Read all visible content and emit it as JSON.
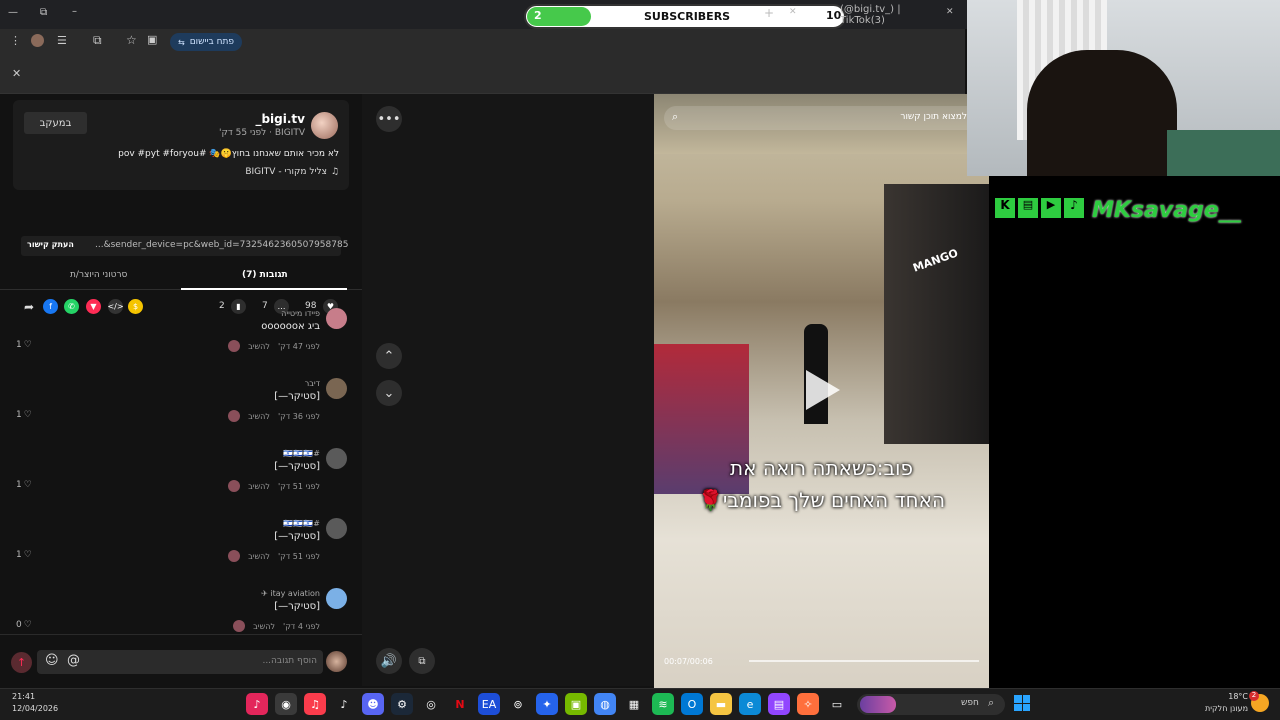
{
  "browser": {
    "tab_subscribers": "SUBSCRIBERS",
    "sub_left": "2",
    "sub_right": "10",
    "tab_title": "(@bigi.tv_) | TikTok(3)",
    "open_app": "פתח ביישום"
  },
  "post": {
    "username": "bigi.tv_",
    "subline": "BIGITV · לפני 55 דק'",
    "follow_label": "במעקב",
    "caption": "לא מכיר אותם שאנחנו בחוץ🤫🎭 #pov #pyt #foryou",
    "sound": "צליל מקורי - BIGITV",
    "likes": "98",
    "comments": "7",
    "saves": "2",
    "link": "...&sender_device=pc&web_id=7325462360507958785",
    "copy_link": "העתק קישור"
  },
  "tabs": {
    "comments": "תגובות (7)",
    "creator_videos": "סרטוני היוצר/ת"
  },
  "comments": [
    {
      "name": "פיידו מיטייה",
      "text": "ביג אoooooo",
      "time": "לפני 47 דק'",
      "reply": "להשיב",
      "likes": "1"
    },
    {
      "name": "דיבר",
      "text": "[סטיקר—]",
      "time": "לפני 36 דק'",
      "reply": "להשיב",
      "likes": "1"
    },
    {
      "name": "#🇮🇱🇮🇱🇮🇱",
      "text": "[סטיקר—]",
      "time": "לפני 51 דק'",
      "reply": "להשיב",
      "likes": "1"
    },
    {
      "name": "#🇮🇱🇮🇱🇮🇱",
      "text": "[סטיקר—]",
      "time": "לפני 51 דק'",
      "reply": "להשיב",
      "likes": "1"
    },
    {
      "name": "itay aviation ✈",
      "text": "[סטיקר—]",
      "time": "לפני 4 דק'",
      "reply": "להשיב",
      "likes": "0"
    }
  ],
  "input": {
    "placeholder": "הוסף תגובה..."
  },
  "video": {
    "search_placeholder": "למצוא תוכן קשור",
    "overlay_line1": "פוב:כשאתה רואה את",
    "overlay_line2": "האחד האחים שלך בפומבי🌹",
    "time": "00:07/00:06",
    "store_sign": "MANGO"
  },
  "stream": {
    "channel": "MKsavage__"
  },
  "taskbar": {
    "time": "21:41",
    "date": "12/04/2026",
    "search": "חפש",
    "weather_temp": "18°C",
    "weather_desc": "מעונן חלקית",
    "notif": "2"
  },
  "colors": {
    "accent": "#fe2c55",
    "sub_green": "#46c94b"
  }
}
